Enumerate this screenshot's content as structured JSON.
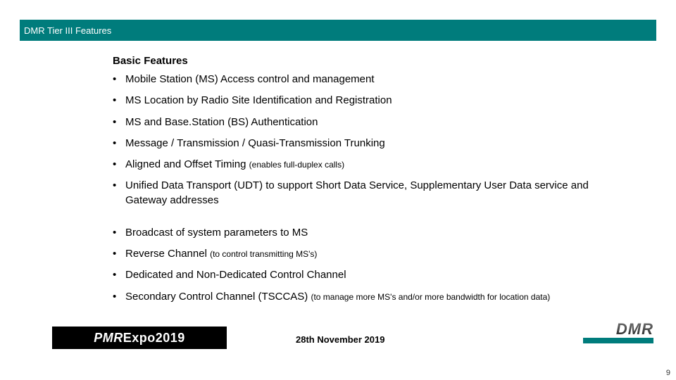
{
  "titleBar": "DMR Tier III Features",
  "sectionTitle": "Basic Features",
  "bullets": [
    {
      "main": "Mobile Station (MS) Access control and management",
      "sub": ""
    },
    {
      "main": "MS Location by Radio Site Identification and Registration",
      "sub": ""
    },
    {
      "main": "MS and Base.Station (BS) Authentication",
      "sub": ""
    },
    {
      "main": "Message / Transmission / Quasi-Transmission Trunking",
      "sub": ""
    },
    {
      "main": "Aligned and Offset Timing ",
      "sub": "(enables full-duplex calls)"
    },
    {
      "main": "Unified Data Transport (UDT) to support Short Data Service, Supplementary User Data service and Gateway addresses",
      "sub": ""
    },
    {
      "main": "Broadcast of system parameters to MS",
      "sub": ""
    },
    {
      "main": "Reverse Channel ",
      "sub": "(to control transmitting MS's)"
    },
    {
      "main": "Dedicated and Non-Dedicated Control Channel",
      "sub": ""
    },
    {
      "main": "Secondary Control Channel (TSCCAS) ",
      "sub": "(to manage more MS's and/or more bandwidth for location data)"
    }
  ],
  "groupBreakAfterIndex": 5,
  "footer": {
    "leftLogo": {
      "part1": "PMR",
      "part2": "Expo ",
      "part3": "2019"
    },
    "date": "28th November 2019",
    "rightLogo": "DMR"
  },
  "pageNumber": "9"
}
